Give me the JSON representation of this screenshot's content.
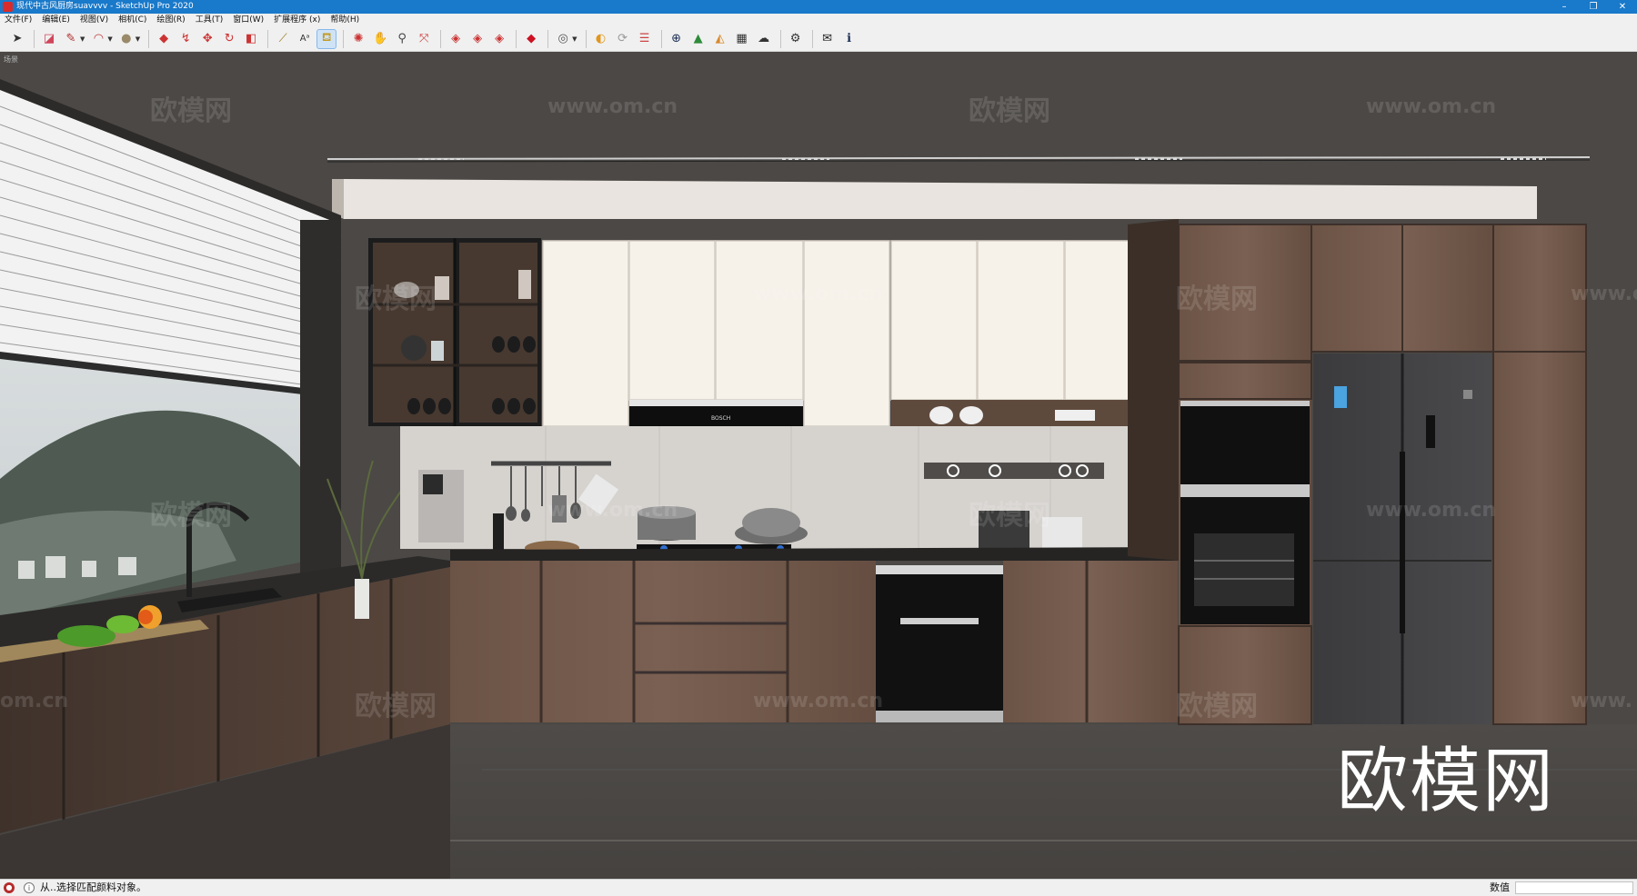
{
  "window": {
    "title": "现代中古风厨房suavvvv - SketchUp Pro 2020",
    "controls": [
      "–",
      "❐",
      "✕"
    ]
  },
  "menu": [
    {
      "label": "文件(F)"
    },
    {
      "label": "编辑(E)"
    },
    {
      "label": "视图(V)"
    },
    {
      "label": "相机(C)"
    },
    {
      "label": "绘图(R)"
    },
    {
      "label": "工具(T)"
    },
    {
      "label": "窗口(W)"
    },
    {
      "label": "扩展程序 (x)"
    },
    {
      "label": "帮助(H)"
    }
  ],
  "toolbar": {
    "tools": [
      {
        "icon": "select-arrow-icon",
        "glyph": "➤"
      },
      {
        "icon": "eraser-icon",
        "glyph": "◪"
      },
      {
        "icon": "pencil-line-icon",
        "glyph": "✎"
      },
      {
        "icon": "arc-icon",
        "glyph": "◠"
      },
      {
        "icon": "shape-icon",
        "glyph": "●"
      },
      {
        "icon": "push-pull-icon",
        "glyph": "◆"
      },
      {
        "icon": "follow-me-icon",
        "glyph": "↯"
      },
      {
        "icon": "move-icon",
        "glyph": "✥"
      },
      {
        "icon": "rotate-icon",
        "glyph": "↻"
      },
      {
        "icon": "scale-icon",
        "glyph": "◧"
      },
      {
        "icon": "tape-measure-icon",
        "glyph": "⟋"
      },
      {
        "icon": "text-icon",
        "glyph": "Aᵃ"
      },
      {
        "icon": "paint-bucket-icon",
        "glyph": "⛾"
      },
      {
        "icon": "orbit-icon",
        "glyph": "✺"
      },
      {
        "icon": "pan-icon",
        "glyph": "✋"
      },
      {
        "icon": "zoom-icon",
        "glyph": "⚲"
      },
      {
        "icon": "zoom-extents-icon",
        "glyph": "⤧"
      },
      {
        "icon": "warehouse-icon",
        "glyph": "◈"
      },
      {
        "icon": "extension-warehouse-icon",
        "glyph": "◈"
      },
      {
        "icon": "layout-icon",
        "glyph": "◈"
      },
      {
        "icon": "ruby-icon",
        "glyph": "◆"
      },
      {
        "icon": "account-icon",
        "glyph": "◎"
      },
      {
        "icon": "plugin-a-icon",
        "glyph": "◐"
      },
      {
        "icon": "refresh-icon",
        "glyph": "⟳"
      },
      {
        "icon": "layers-icon",
        "glyph": "☰"
      },
      {
        "icon": "add-location-icon",
        "glyph": "⊕"
      },
      {
        "icon": "tree-icon",
        "glyph": "▲"
      },
      {
        "icon": "terrain-icon",
        "glyph": "◭"
      },
      {
        "icon": "checker-icon",
        "glyph": "▦"
      },
      {
        "icon": "cloud-upload-icon",
        "glyph": "☁"
      },
      {
        "icon": "settings-icon",
        "glyph": "⚙"
      },
      {
        "icon": "mail-icon",
        "glyph": "✉"
      },
      {
        "icon": "info-icon",
        "glyph": "ℹ"
      }
    ]
  },
  "scene": {
    "label": "场景",
    "wall_color": "#4b4845",
    "watermarks": [
      {
        "text": "欧模网"
      },
      {
        "text": "www.om.cn"
      },
      {
        "text": "欧模网"
      },
      {
        "text": "www.om.cn"
      },
      {
        "text": "欧模网"
      },
      {
        "text": "www.om.cn"
      },
      {
        "text": "欧模网"
      },
      {
        "text": "www.o"
      },
      {
        "text": "欧模网"
      },
      {
        "text": "www.om.cn"
      },
      {
        "text": "欧模网"
      },
      {
        "text": "www.om.cn"
      },
      {
        "text": "欧模网"
      },
      {
        "text": "www.om.cn"
      },
      {
        "text": "欧模网"
      },
      {
        "text": "om.cn"
      },
      {
        "text": "www."
      }
    ],
    "big_watermark": "欧模网",
    "hood_brand": "BOSCH"
  },
  "status": {
    "message": "从..选择匹配颜料对象。",
    "vcb_label": "数值",
    "vcb_value": ""
  }
}
